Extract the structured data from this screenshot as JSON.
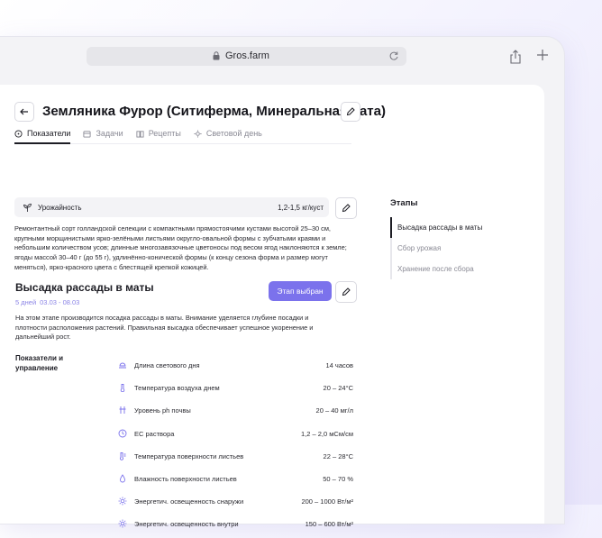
{
  "browser": {
    "url": "Gros.farm"
  },
  "page": {
    "title": "Земляника Фурор (Ситиферма, Минеральная вата)",
    "tabs": [
      {
        "label": "Показатели",
        "icon": "gauge-icon",
        "active": true
      },
      {
        "label": "Задачи",
        "icon": "calendar-icon",
        "active": false
      },
      {
        "label": "Рецепты",
        "icon": "book-icon",
        "active": false
      },
      {
        "label": "Световой день",
        "icon": "sun-icon",
        "active": false
      }
    ],
    "yield": {
      "label": "Урожайность",
      "value": "1,2-1,5 кг/куст"
    },
    "description": "Ремонтантный сорт голландской селекции с компактными прямостоячими кустами высотой 25–30 см, крупными морщинистыми ярко-зелёными листьями округло-овальной формы с зубчатыми краями и небольшим количеством усов; длинные многозавязочные цветоносы под весом ягод наклоняются к земле; ягоды массой 30–40 г (до 55 г), удлинённо-конической формы (к концу сезона форма и размер могут меняться), ярко-красного цвета с блестящей крепкой кожицей.",
    "stage": {
      "title": "Высадка рассады в маты",
      "days": "5 дней",
      "dates": "03.03 - 08.03",
      "button_label": "Этап выбран",
      "description": "На этом этапе производится посадка рассады в маты. Внимание уделяется глубине посадки и плотности расположения растений. Правильная высадка обеспечивает успешное укоренение и дальнейший рост."
    },
    "indicators": {
      "label": "Показатели и управление",
      "rows": [
        {
          "name": "Длина светового дня",
          "value": "14 часов",
          "icon": "daylight-icon"
        },
        {
          "name": "Температура воздуха днем",
          "value": "20 – 24°C",
          "icon": "thermometer-icon"
        },
        {
          "name": "Уровень ph почвы",
          "value": "20 – 40 мг/л",
          "icon": "ph-icon"
        },
        {
          "name": "EC раствора",
          "value": "1,2 – 2,0 мСм/см",
          "icon": "ec-icon"
        },
        {
          "name": "Температура поверхности листьев",
          "value": "22 – 28°C",
          "icon": "leaf-temp-icon"
        },
        {
          "name": "Влажность поверхности листьев",
          "value": "50 – 70 %",
          "icon": "drop-icon"
        },
        {
          "name": "Энергетич. освещенность снаружи",
          "value": "200 – 1000 Вт/м²",
          "icon": "sun-icon"
        },
        {
          "name": "Энергетич. освещенность внутри",
          "value": "150 – 600 Вт/м²",
          "icon": "sun-icon"
        }
      ]
    },
    "stages_panel": {
      "title": "Этапы",
      "items": [
        {
          "label": "Высадка рассады в маты",
          "active": true
        },
        {
          "label": "Сбор урожая",
          "active": false
        },
        {
          "label": "Хранение после сбора",
          "active": false
        }
      ]
    }
  },
  "colors": {
    "accent": "#7b72ec",
    "text": "#1d1d24",
    "muted": "#8a8a95"
  }
}
